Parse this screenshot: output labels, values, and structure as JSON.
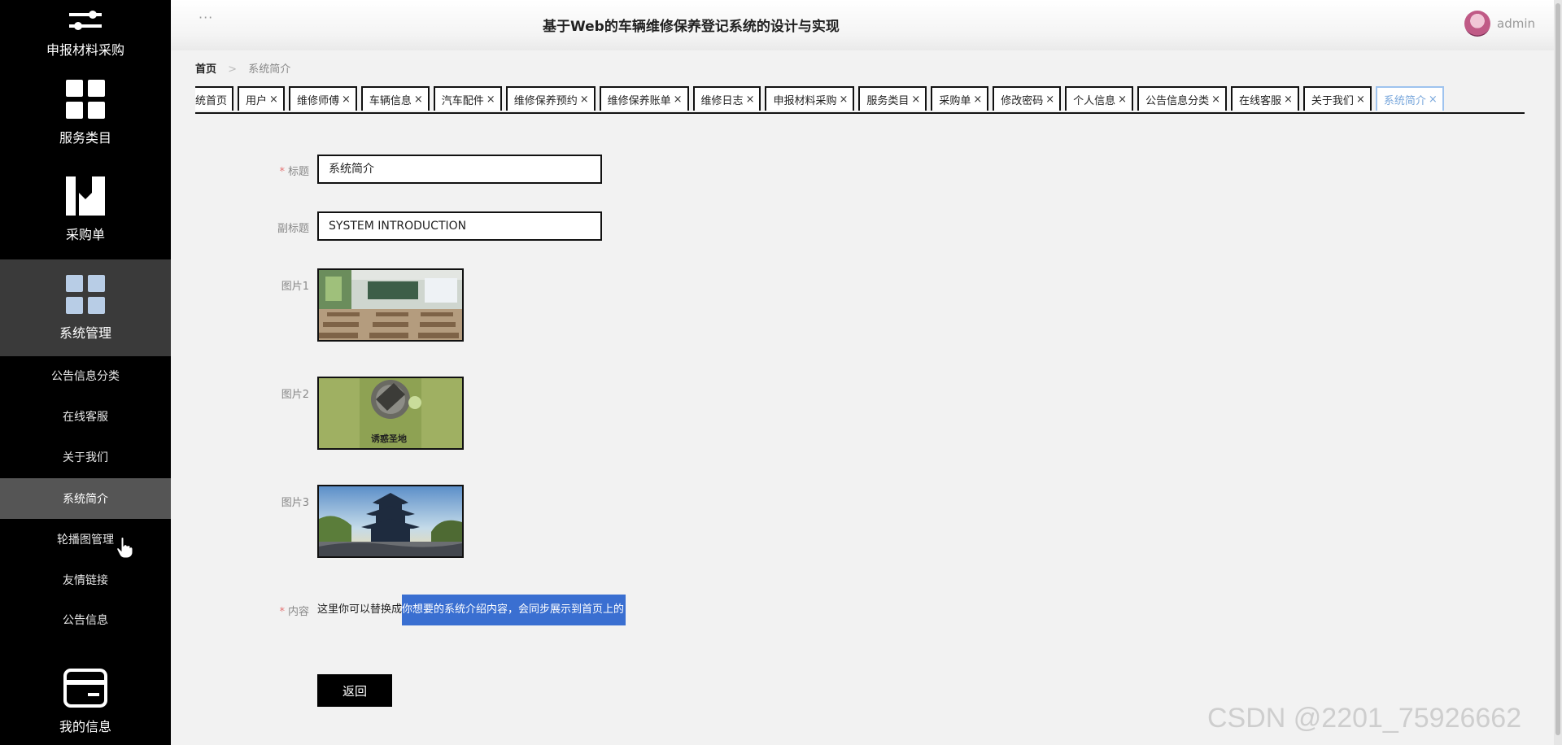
{
  "sidebar": {
    "items": [
      {
        "label": "申报材料采购",
        "icon": "sliders-icon"
      },
      {
        "label": "服务类目",
        "icon": "grid-icon"
      },
      {
        "label": "采购单",
        "icon": "bookmark-icon"
      },
      {
        "label": "系统管理",
        "icon": "grid-icon",
        "active": true
      }
    ],
    "sub_items": [
      "公告信息分类",
      "在线客服",
      "关于我们",
      "系统简介",
      "轮播图管理",
      "友情链接",
      "公告信息"
    ],
    "active_sub": "系统简介",
    "bottom_item": {
      "label": "我的信息",
      "icon": "card-icon"
    }
  },
  "header": {
    "menu_dots": "···",
    "title": "基于Web的车辆维修保养登记系统的设计与实现",
    "user": "admin"
  },
  "breadcrumb": {
    "home": "首页",
    "separator": ">",
    "current": "系统简介"
  },
  "tabs": [
    "统首页",
    "用户",
    "维修师傅",
    "车辆信息",
    "汽车配件",
    "维修保养预约",
    "维修保养账单",
    "维修日志",
    "申报材料采购",
    "服务类目",
    "采购单",
    "修改密码",
    "个人信息",
    "公告信息分类",
    "在线客服",
    "关于我们",
    "系统简介"
  ],
  "active_tab": "系统简介",
  "tab_close_symbol": "×",
  "form": {
    "title_label": "标题",
    "title_value": "系统简介",
    "subtitle_label": "副标题",
    "subtitle_value": "SYSTEM INTRODUCTION",
    "image1_label": "图片1",
    "image2_label": "图片2",
    "image3_label": "图片3",
    "image2_caption": "诱惑圣地",
    "content_label": "内容",
    "content_plain": "这里你可以替换成",
    "content_selected": "你想要的系统介绍内容，会同步展示到首页上的",
    "required_mark": "*",
    "back_button": "返回"
  },
  "watermark": "CSDN @2201_75926662",
  "colors": {
    "sidebar_bg": "#000000",
    "sidebar_active": "#3a3a3a",
    "sidebar_sub_active": "#555555",
    "active_tab": "#7aa8dc",
    "selection": "#3a6fd1",
    "icon_blue": "#b8cde6"
  }
}
